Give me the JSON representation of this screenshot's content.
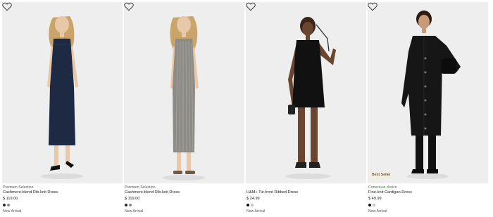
{
  "products": [
    {
      "tag": "Premium Selection",
      "tag_style": "premium",
      "title": "Cashmere-blend Rib-knit Dress",
      "price": "$ 119.00",
      "swatches": [
        "#1e2a44",
        "#8a8a88"
      ],
      "label": "New Arrival",
      "badge": "",
      "image_icon": "model-navy-dress"
    },
    {
      "tag": "Premium Selection",
      "tag_style": "premium",
      "title": "Cashmere-blend Rib-knit Dress",
      "price": "$ 119.00",
      "swatches": [
        "#1e2a44",
        "#8a8a88"
      ],
      "label": "New Arrival",
      "badge": "",
      "image_icon": "model-grey-dress"
    },
    {
      "tag": "",
      "tag_style": "none",
      "title": "H&M+ Tie-front Ribbed Dress",
      "price": "$ 24.99",
      "swatches": [
        "#111111",
        "#d8d0c4"
      ],
      "label": "New Arrival",
      "badge": "",
      "image_icon": "model-black-dress"
    },
    {
      "tag": "Conscious choice",
      "tag_style": "conscious",
      "title": "Fine-knit Cardigan Dress",
      "price": "$ 49.99",
      "swatches": [
        "#111111",
        "#d8d0c4"
      ],
      "label": "New Arrival",
      "badge": "Best Seller",
      "image_icon": "model-black-cardigan"
    }
  ],
  "icons": {
    "favorite": "heart-outline-icon"
  },
  "colors": {
    "image_bg": "#ececec",
    "badge_bg": "#f4ede1",
    "conscious_tag": "#3a7a3a"
  }
}
